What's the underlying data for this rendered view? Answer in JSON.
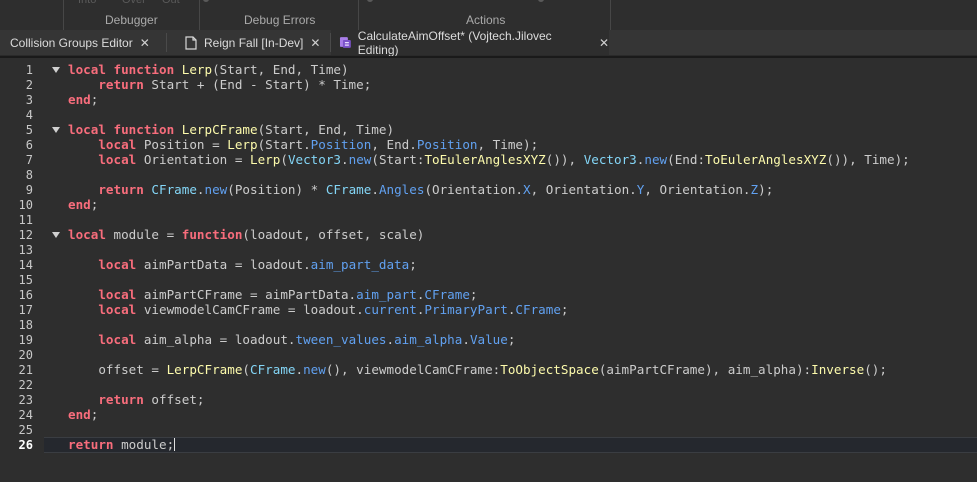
{
  "ribbon": {
    "groups": [
      "Debugger",
      "Debug Errors",
      "Actions"
    ]
  },
  "tabs": [
    {
      "label": "Collision Groups Editor",
      "icon": "none",
      "active": false
    },
    {
      "label": "Reign Fall [In-Dev]",
      "icon": "file-icon",
      "active": false
    },
    {
      "label": "CalculateAimOffset* (Vojtech.Jilovec Editing)",
      "icon": "script-icon",
      "active": true
    }
  ],
  "close_glyph": "✕",
  "editor": {
    "current_line": 26,
    "fold_lines": [
      1,
      5,
      12
    ],
    "lines": [
      [
        [
          "kw",
          "local "
        ],
        [
          "kw",
          "function "
        ],
        [
          "fn",
          "Lerp"
        ],
        [
          "id",
          "(Start, End, Time)"
        ]
      ],
      [
        [
          "id",
          "    "
        ],
        [
          "kw",
          "return "
        ],
        [
          "id",
          "Start + (End - Start) * Time;"
        ]
      ],
      [
        [
          "kw",
          "end"
        ],
        [
          "id",
          ";"
        ]
      ],
      [],
      [
        [
          "kw",
          "local "
        ],
        [
          "kw",
          "function "
        ],
        [
          "fn",
          "LerpCFrame"
        ],
        [
          "id",
          "(Start, End, Time)"
        ]
      ],
      [
        [
          "id",
          "    "
        ],
        [
          "kw",
          "local "
        ],
        [
          "id",
          "Position = "
        ],
        [
          "fn",
          "Lerp"
        ],
        [
          "id",
          "(Start."
        ],
        [
          "prop",
          "Position"
        ],
        [
          "id",
          ", End."
        ],
        [
          "prop",
          "Position"
        ],
        [
          "id",
          ", Time);"
        ]
      ],
      [
        [
          "id",
          "    "
        ],
        [
          "kw",
          "local "
        ],
        [
          "id",
          "Orientation = "
        ],
        [
          "fn",
          "Lerp"
        ],
        [
          "id",
          "("
        ],
        [
          "bi",
          "Vector3"
        ],
        [
          "id",
          "."
        ],
        [
          "prop",
          "new"
        ],
        [
          "id",
          "(Start:"
        ],
        [
          "fn",
          "ToEulerAnglesXYZ"
        ],
        [
          "id",
          "()), "
        ],
        [
          "bi",
          "Vector3"
        ],
        [
          "id",
          "."
        ],
        [
          "prop",
          "new"
        ],
        [
          "id",
          "(End:"
        ],
        [
          "fn",
          "ToEulerAnglesXYZ"
        ],
        [
          "id",
          "()), Time);"
        ]
      ],
      [],
      [
        [
          "id",
          "    "
        ],
        [
          "kw",
          "return "
        ],
        [
          "bi",
          "CFrame"
        ],
        [
          "id",
          "."
        ],
        [
          "prop",
          "new"
        ],
        [
          "id",
          "(Position) * "
        ],
        [
          "bi",
          "CFrame"
        ],
        [
          "id",
          "."
        ],
        [
          "prop",
          "Angles"
        ],
        [
          "id",
          "(Orientation."
        ],
        [
          "prop",
          "X"
        ],
        [
          "id",
          ", Orientation."
        ],
        [
          "prop",
          "Y"
        ],
        [
          "id",
          ", Orientation."
        ],
        [
          "prop",
          "Z"
        ],
        [
          "id",
          ");"
        ]
      ],
      [
        [
          "kw",
          "end"
        ],
        [
          "id",
          ";"
        ]
      ],
      [],
      [
        [
          "kw",
          "local "
        ],
        [
          "id",
          "module = "
        ],
        [
          "kw",
          "function"
        ],
        [
          "id",
          "(loadout, offset, scale)"
        ]
      ],
      [],
      [
        [
          "id",
          "    "
        ],
        [
          "kw",
          "local "
        ],
        [
          "id",
          "aimPartData = loadout."
        ],
        [
          "prop",
          "aim_part_data"
        ],
        [
          "id",
          ";"
        ]
      ],
      [],
      [
        [
          "id",
          "    "
        ],
        [
          "kw",
          "local "
        ],
        [
          "id",
          "aimPartCFrame = aimPartData."
        ],
        [
          "prop",
          "aim_part"
        ],
        [
          "id",
          "."
        ],
        [
          "prop",
          "CFrame"
        ],
        [
          "id",
          ";"
        ]
      ],
      [
        [
          "id",
          "    "
        ],
        [
          "kw",
          "local "
        ],
        [
          "id",
          "viewmodelCamCFrame = loadout."
        ],
        [
          "prop",
          "current"
        ],
        [
          "id",
          "."
        ],
        [
          "prop",
          "PrimaryPart"
        ],
        [
          "id",
          "."
        ],
        [
          "prop",
          "CFrame"
        ],
        [
          "id",
          ";"
        ]
      ],
      [],
      [
        [
          "id",
          "    "
        ],
        [
          "kw",
          "local "
        ],
        [
          "id",
          "aim_alpha = loadout."
        ],
        [
          "prop",
          "tween_values"
        ],
        [
          "id",
          "."
        ],
        [
          "prop",
          "aim_alpha"
        ],
        [
          "id",
          "."
        ],
        [
          "prop",
          "Value"
        ],
        [
          "id",
          ";"
        ]
      ],
      [],
      [
        [
          "id",
          "    offset = "
        ],
        [
          "fn",
          "LerpCFrame"
        ],
        [
          "id",
          "("
        ],
        [
          "bi",
          "CFrame"
        ],
        [
          "id",
          "."
        ],
        [
          "prop",
          "new"
        ],
        [
          "id",
          "(), viewmodelCamCFrame:"
        ],
        [
          "fn",
          "ToObjectSpace"
        ],
        [
          "id",
          "(aimPartCFrame), aim_alpha):"
        ],
        [
          "fn",
          "Inverse"
        ],
        [
          "id",
          "();"
        ]
      ],
      [],
      [
        [
          "id",
          "    "
        ],
        [
          "kw",
          "return "
        ],
        [
          "id",
          "offset;"
        ]
      ],
      [
        [
          "kw",
          "end"
        ],
        [
          "id",
          ";"
        ]
      ],
      [],
      [
        [
          "kw",
          "return "
        ],
        [
          "id",
          "module;"
        ]
      ]
    ]
  }
}
